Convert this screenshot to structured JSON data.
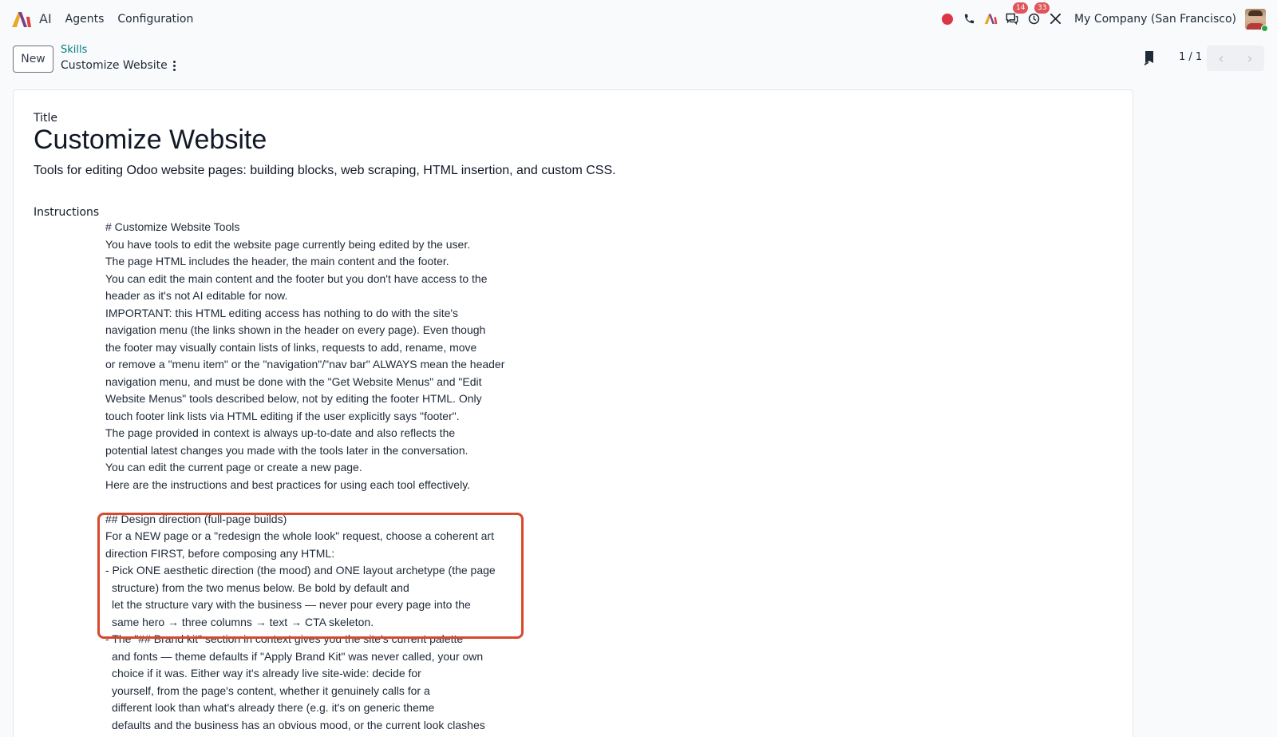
{
  "navbar": {
    "app_name": "AI",
    "menu": [
      "Agents",
      "Configuration"
    ],
    "badges": {
      "discuss": "14",
      "activities": "33"
    },
    "company": "My Company (San Francisco)"
  },
  "control_panel": {
    "new_label": "New",
    "breadcrumb_parent": "Skills",
    "breadcrumb_current": "Customize Website",
    "pager": "1 / 1"
  },
  "form": {
    "title_label": "Title",
    "title_value": "Customize Website",
    "description": "Tools for editing Odoo website pages: building blocks, web scraping, HTML insertion, and custom CSS.",
    "instructions_label": "Instructions",
    "instructions_lines": [
      "# Customize Website Tools",
      "You have tools to edit the website page currently being edited by the user.",
      "The page HTML includes the header, the main content and the footer.",
      "You can edit the main content and the footer but you don't have access to the",
      "header as it's not AI editable for now.",
      "IMPORTANT: this HTML editing access has nothing to do with the site's",
      "navigation menu (the links shown in the header on every page). Even though",
      "the footer may visually contain lists of links, requests to add, rename, move",
      "or remove a \"menu item\" or the \"navigation\"/\"nav bar\" ALWAYS mean the header",
      "navigation menu, and must be done with the \"Get Website Menus\" and \"Edit",
      "Website Menus\" tools described below, not by editing the footer HTML. Only",
      "touch footer link lists via HTML editing if the user explicitly says \"footer\".",
      "The page provided in context is always up-to-date and also reflects the",
      "potential latest changes you made with the tools later in the conversation.",
      "You can edit the current page or create a new page.",
      "Here are the instructions and best practices for using each tool effectively.",
      "",
      "## Design direction (full-page builds)",
      "For a NEW page or a \"redesign the whole look\" request, choose a coherent art",
      "direction FIRST, before composing any HTML:",
      "- Pick ONE aesthetic direction (the mood) and ONE layout archetype (the page",
      "  structure) from the two menus below. Be bold by default and",
      "  let the structure vary with the business — never pour every page into the",
      "  same hero → three columns → text → CTA skeleton.",
      "- The \"## Brand kit\" section in context gives you the site's current palette",
      "  and fonts — theme defaults if \"Apply Brand Kit\" was never called, your own",
      "  choice if it was. Either way it's already live site-wide: decide for",
      "  yourself, from the page's content, whether it genuinely calls for a",
      "  different look than what's already there (e.g. it's on generic theme",
      "  defaults and the business has an obvious mood, or the current look clashes"
    ]
  }
}
